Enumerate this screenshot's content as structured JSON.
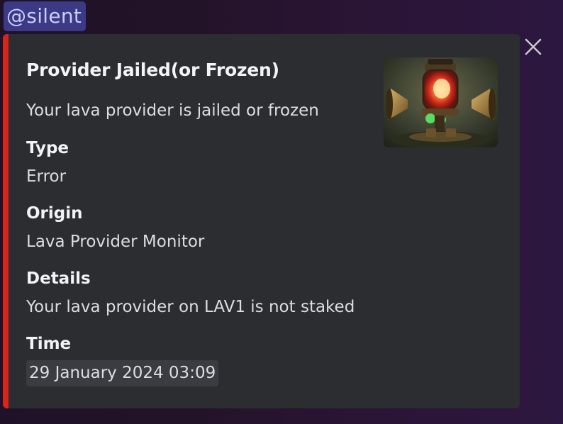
{
  "mention": {
    "text": "@silent"
  },
  "embed": {
    "accent_color": "#d9241a",
    "title": "Provider Jailed(or Frozen)",
    "description": "Your lava provider is jailed or frozen",
    "fields": [
      {
        "name": "Type",
        "value": "Error"
      },
      {
        "name": "Origin",
        "value": "Lava Provider Monitor"
      },
      {
        "name": "Details",
        "value": "Your lava provider on LAV1 is not staked"
      },
      {
        "name": "Time",
        "value": "29 January 2024 03:09"
      }
    ],
    "thumbnail_icon": "lantern-robot-thumbnail",
    "close_icon": "close-icon"
  }
}
